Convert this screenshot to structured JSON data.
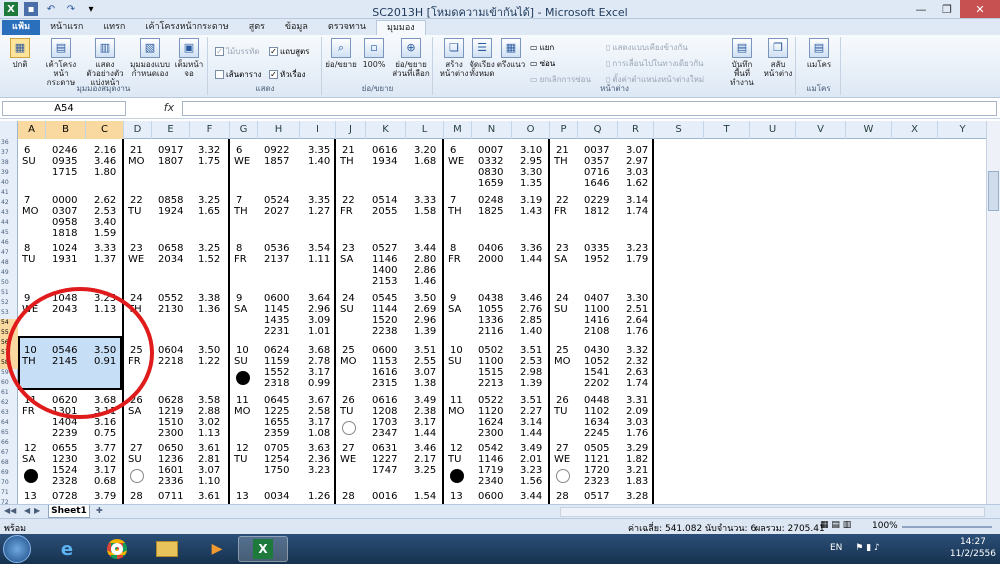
{
  "app": {
    "window_title": "SC2013H  [โหมดความเข้ากันได้] - Microsoft Excel"
  },
  "tabs": [
    "แฟ้ม",
    "หน้าแรก",
    "แทรก",
    "เค้าโครงหน้ากระดาษ",
    "สูตร",
    "ข้อมูล",
    "ตรวจทาน",
    "มุมมอง"
  ],
  "active_tab": "มุมมอง",
  "ribbon": {
    "group_views": {
      "label": "มุมมองสมุดงาน",
      "normal": "ปกติ",
      "page_layout": "เค้าโครงหน้ากระดาษ",
      "page_break": "แสดงตัวอย่างตัวแบ่งหน้า",
      "custom_views": "มุมมองแบบกำหนดเอง",
      "full_screen": "เต็มหน้าจอ"
    },
    "group_show": {
      "label": "แสดง",
      "ruler": "ไม้บรรทัด",
      "formula_bar": "แถบสูตร",
      "gridlines": "เส้นตาราง",
      "headings": "หัวเรื่อง"
    },
    "group_zoom": {
      "label": "ย่อ/ขยาย",
      "zoom": "ย่อ/ขยาย",
      "hundred": "100%",
      "zoom_to_selection": "ย่อ/ขยายส่วนที่เลือก"
    },
    "group_window": {
      "label": "หน้าต่าง",
      "new_window": "สร้างหน้าต่าง",
      "arrange_all": "จัดเรียงทั้งหมด",
      "freeze_panes": "ตรึงแนว",
      "split": "แยก",
      "hide": "ซ่อน",
      "unhide": "ยกเลิกการซ่อน",
      "view_side_by_side": "แสดงแบบเคียงข้างกัน",
      "synchronous_scrolling": "การเลื่อนไปในทางเดียวกัน",
      "reset_window": "ตั้งค่าตำแหน่งหน้าต่างใหม่",
      "save_workspace": "บันทึกพื้นที่ทำงาน",
      "switch_windows": "สลับหน้าต่าง"
    },
    "group_macros": {
      "label": "แมโคร",
      "macros": "แมโคร"
    }
  },
  "namebox": "A54",
  "fx": "fx",
  "columns": [
    "A",
    "B",
    "C",
    "D",
    "E",
    "F",
    "G",
    "H",
    "I",
    "J",
    "K",
    "L",
    "M",
    "N",
    "O",
    "P",
    "Q",
    "R",
    "S",
    "T",
    "U",
    "V",
    "W",
    "X",
    "Y"
  ],
  "row_numbers": [
    "36",
    "37",
    "38",
    "39",
    "40",
    "41",
    "42",
    "43",
    "44",
    "45",
    "46",
    "47",
    "48",
    "49",
    "50",
    "51",
    "52",
    "53",
    "54",
    "55",
    "56",
    "57",
    "58",
    "59",
    "60",
    "61",
    "62",
    "63",
    "64",
    "65",
    "66",
    "67",
    "68",
    "69",
    "70",
    "71",
    "72"
  ],
  "blocks": [
    [
      {
        "d": "6",
        "w": "SU",
        "t": [
          "0246",
          "0935",
          "1715"
        ],
        "h": [
          "2.16",
          "3.46",
          "1.80"
        ]
      },
      {
        "d": "21",
        "w": "MO",
        "t": [
          "0917",
          "1807"
        ],
        "h": [
          "3.32",
          "1.75"
        ]
      },
      {
        "d": "6",
        "w": "WE",
        "t": [
          "0922",
          "1857"
        ],
        "h": [
          "3.35",
          "1.40"
        ]
      },
      {
        "d": "21",
        "w": "TH",
        "t": [
          "0616",
          "1934"
        ],
        "h": [
          "3.20",
          "1.68"
        ]
      },
      {
        "d": "6",
        "w": "WE",
        "t": [
          "0007",
          "0332",
          "0830",
          "1659"
        ],
        "h": [
          "3.10",
          "2.95",
          "3.30",
          "1.35"
        ]
      },
      {
        "d": "21",
        "w": "TH",
        "t": [
          "0037",
          "0357",
          "0716",
          "1646"
        ],
        "h": [
          "3.07",
          "2.97",
          "3.03",
          "1.62"
        ]
      }
    ],
    [
      {
        "d": "7",
        "w": "MO",
        "t": [
          "0000",
          "0307",
          "0958",
          "1818"
        ],
        "h": [
          "2.62",
          "2.53",
          "3.40",
          "1.59"
        ]
      },
      {
        "d": "22",
        "w": "TU",
        "t": [
          "0858",
          "1924"
        ],
        "h": [
          "3.25",
          "1.65"
        ]
      },
      {
        "d": "7",
        "w": "TH",
        "t": [
          "0524",
          "2027"
        ],
        "h": [
          "3.35",
          "1.27"
        ]
      },
      {
        "d": "22",
        "w": "FR",
        "t": [
          "0514",
          "2055"
        ],
        "h": [
          "3.33",
          "1.58"
        ]
      },
      {
        "d": "7",
        "w": "TH",
        "t": [
          "0248",
          "1825"
        ],
        "h": [
          "3.19",
          "1.43"
        ]
      },
      {
        "d": "22",
        "w": "FR",
        "t": [
          "0229",
          "1812"
        ],
        "h": [
          "3.14",
          "1.74"
        ]
      }
    ],
    [
      {
        "d": "8",
        "w": "TU",
        "t": [
          "1024",
          "1931"
        ],
        "h": [
          "3.33",
          "1.37"
        ]
      },
      {
        "d": "23",
        "w": "WE",
        "t": [
          "0658",
          "2034"
        ],
        "h": [
          "3.25",
          "1.52"
        ]
      },
      {
        "d": "8",
        "w": "FR",
        "t": [
          "0536",
          "2137"
        ],
        "h": [
          "3.54",
          "1.11"
        ]
      },
      {
        "d": "23",
        "w": "SA",
        "t": [
          "0527",
          "1146",
          "1400",
          "2153"
        ],
        "h": [
          "3.44",
          "2.80",
          "2.86",
          "1.46"
        ]
      },
      {
        "d": "8",
        "w": "FR",
        "t": [
          "0406",
          "2000"
        ],
        "h": [
          "3.36",
          "1.44"
        ]
      },
      {
        "d": "23",
        "w": "SA",
        "t": [
          "0335",
          "1952"
        ],
        "h": [
          "3.23",
          "1.79"
        ]
      }
    ],
    [
      {
        "d": "9",
        "w": "WE",
        "t": [
          "1048",
          "2043"
        ],
        "h": [
          "3.25",
          "1.13"
        ]
      },
      {
        "d": "24",
        "w": "TH",
        "t": [
          "0552",
          "2130"
        ],
        "h": [
          "3.38",
          "1.36"
        ]
      },
      {
        "d": "9",
        "w": "SA",
        "t": [
          "0600",
          "1145",
          "1435",
          "2231"
        ],
        "h": [
          "3.64",
          "2.96",
          "3.09",
          "1.01"
        ]
      },
      {
        "d": "24",
        "w": "SU",
        "t": [
          "0545",
          "1144",
          "1520",
          "2238"
        ],
        "h": [
          "3.50",
          "2.69",
          "2.96",
          "1.39"
        ]
      },
      {
        "d": "9",
        "w": "SA",
        "t": [
          "0438",
          "1055",
          "1336",
          "2116"
        ],
        "h": [
          "3.46",
          "2.76",
          "2.85",
          "1.40"
        ]
      },
      {
        "d": "24",
        "w": "SU",
        "t": [
          "0407",
          "1100",
          "1416",
          "2108"
        ],
        "h": [
          "3.30",
          "2.51",
          "2.64",
          "1.76"
        ]
      }
    ],
    [
      {
        "d": "10",
        "w": "TH",
        "t": [
          "0546",
          "2145"
        ],
        "h": [
          "3.50",
          "0.91"
        ]
      },
      {
        "d": "25",
        "w": "FR",
        "t": [
          "0604",
          "2218"
        ],
        "h": [
          "3.50",
          "1.22"
        ]
      },
      {
        "d": "10",
        "w": "SU",
        "t": [
          "0624",
          "1159",
          "1552",
          "2318"
        ],
        "h": [
          "3.68",
          "2.78",
          "3.17",
          "0.99"
        ]
      },
      {
        "d": "25",
        "w": "MO",
        "t": [
          "0600",
          "1153",
          "1616",
          "2315"
        ],
        "h": [
          "3.51",
          "2.55",
          "3.07",
          "1.38"
        ]
      },
      {
        "d": "10",
        "w": "SU",
        "t": [
          "0502",
          "1100",
          "1515",
          "2213"
        ],
        "h": [
          "3.51",
          "2.53",
          "2.98",
          "1.39"
        ]
      },
      {
        "d": "25",
        "w": "MO",
        "t": [
          "0430",
          "1052",
          "1541",
          "2202"
        ],
        "h": [
          "3.32",
          "2.32",
          "2.63",
          "1.74"
        ]
      }
    ],
    [
      {
        "d": "11",
        "w": "FR",
        "t": [
          "0620",
          "1301",
          "1404",
          "2239"
        ],
        "h": [
          "3.68",
          "3.11",
          "3.16",
          "0.75"
        ]
      },
      {
        "d": "26",
        "w": "SA",
        "t": [
          "0628",
          "1219",
          "1510",
          "2300"
        ],
        "h": [
          "3.58",
          "2.88",
          "3.02",
          "1.13"
        ]
      },
      {
        "d": "11",
        "w": "MO",
        "t": [
          "0645",
          "1225",
          "1655",
          "2359"
        ],
        "h": [
          "3.67",
          "2.58",
          "3.17",
          "1.08"
        ]
      },
      {
        "d": "26",
        "w": "TU",
        "t": [
          "0616",
          "1208",
          "1703",
          "2347"
        ],
        "h": [
          "3.49",
          "2.38",
          "3.17",
          "1.44"
        ]
      },
      {
        "d": "11",
        "w": "MO",
        "t": [
          "0522",
          "1120",
          "1624",
          "2300"
        ],
        "h": [
          "3.51",
          "2.27",
          "3.14",
          "1.44"
        ]
      },
      {
        "d": "26",
        "w": "TU",
        "t": [
          "0448",
          "1102",
          "1634",
          "2245"
        ],
        "h": [
          "3.31",
          "2.09",
          "3.03",
          "1.76"
        ]
      }
    ],
    [
      {
        "d": "12",
        "w": "SA",
        "t": [
          "0655",
          "1230",
          "1524",
          "2328"
        ],
        "h": [
          "3.77",
          "3.02",
          "3.17",
          "0.68"
        ]
      },
      {
        "d": "27",
        "w": "SU",
        "t": [
          "0650",
          "1236",
          "1601",
          "2336"
        ],
        "h": [
          "3.61",
          "2.81",
          "3.07",
          "1.10"
        ]
      },
      {
        "d": "12",
        "w": "TU",
        "t": [
          "0705",
          "1254",
          "1750"
        ],
        "h": [
          "3.63",
          "2.36",
          "3.23"
        ]
      },
      {
        "d": "27",
        "w": "WE",
        "t": [
          "0631",
          "1227",
          "1747"
        ],
        "h": [
          "3.46",
          "2.17",
          "3.25"
        ]
      },
      {
        "d": "12",
        "w": "TU",
        "t": [
          "0542",
          "1146",
          "1719",
          "2340"
        ],
        "h": [
          "3.49",
          "2.01",
          "3.23",
          "1.56"
        ]
      },
      {
        "d": "27",
        "w": "WE",
        "t": [
          "0505",
          "1121",
          "1720",
          "2323"
        ],
        "h": [
          "3.29",
          "1.82",
          "3.21",
          "1.83"
        ]
      }
    ],
    [
      {
        "d": "13",
        "w": "",
        "t": [
          "0728"
        ],
        "h": [
          "3.79"
        ]
      },
      {
        "d": "28",
        "w": "",
        "t": [
          "0711"
        ],
        "h": [
          "3.61"
        ]
      },
      {
        "d": "13",
        "w": "",
        "t": [
          "0034"
        ],
        "h": [
          "1.26"
        ]
      },
      {
        "d": "28",
        "w": "",
        "t": [
          "0016"
        ],
        "h": [
          "1.54"
        ]
      },
      {
        "d": "13",
        "w": "",
        "t": [
          "0600"
        ],
        "h": [
          "3.44"
        ]
      },
      {
        "d": "28",
        "w": "",
        "t": [
          "0517"
        ],
        "h": [
          "3.28"
        ]
      }
    ]
  ],
  "moons": [
    {
      "block": 4,
      "group": 2,
      "type": "new"
    },
    {
      "block": 5,
      "group": 3,
      "type": "full"
    },
    {
      "block": 6,
      "group": 0,
      "type": "new"
    },
    {
      "block": 6,
      "group": 1,
      "type": "full"
    },
    {
      "block": 6,
      "group": 4,
      "type": "new"
    },
    {
      "block": 6,
      "group": 5,
      "type": "full"
    }
  ],
  "sheet_tab": "Sheet1",
  "status": {
    "ready": "พร้อม",
    "average": "ค่าเฉลี่ย: 541.082",
    "count": "นับจำนวน: 6",
    "sum": "ผลรวม: 2705.41",
    "zoom": "100%"
  },
  "taskbar": {
    "lang": "EN",
    "time": "14:27",
    "date": "11/2/2556"
  }
}
